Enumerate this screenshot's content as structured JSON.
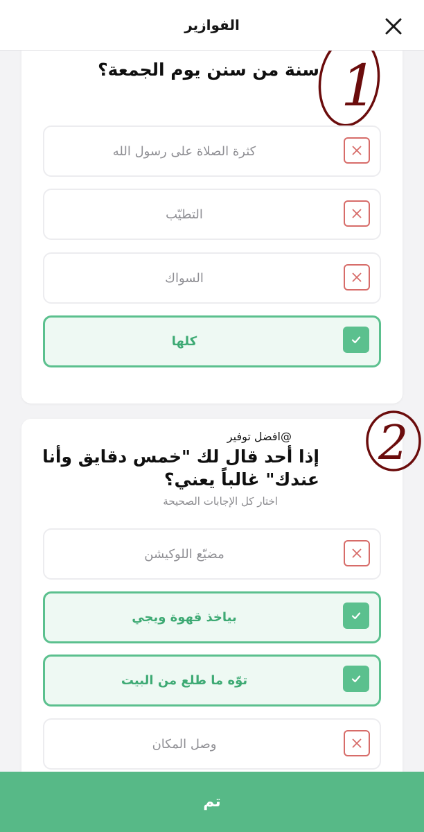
{
  "header": {
    "title": "الفوازير"
  },
  "question1": {
    "number_badge": "1",
    "title": "سنة من سنن يوم الجمعة؟",
    "options": [
      {
        "label": "كثرة الصلاة على رسول الله",
        "state": "wrong"
      },
      {
        "label": "التطيّب",
        "state": "wrong"
      },
      {
        "label": "السواك",
        "state": "wrong"
      },
      {
        "label": "كلها",
        "state": "correct"
      }
    ]
  },
  "question2": {
    "number_badge": "2",
    "handle": "@افضل توفير",
    "title": "إذا أحد قال لك \"خمس دقايق وأنا عندك\" غالباً يعني؟",
    "hint": "اختار كل الإجابات الصحيحة",
    "options": [
      {
        "label": "مضيّع اللوكيشن",
        "state": "wrong"
      },
      {
        "label": "بياخذ قهوة ويجي",
        "state": "correct"
      },
      {
        "label": "توّه ما طلع من البيت",
        "state": "correct"
      },
      {
        "label": "وصل المكان",
        "state": "wrong"
      }
    ]
  },
  "footer": {
    "done_label": "تم"
  },
  "colors": {
    "correct": "#5bc08e",
    "wrong": "#d76c69",
    "badge": "#6b0c0c",
    "done_bar": "#57b987"
  }
}
